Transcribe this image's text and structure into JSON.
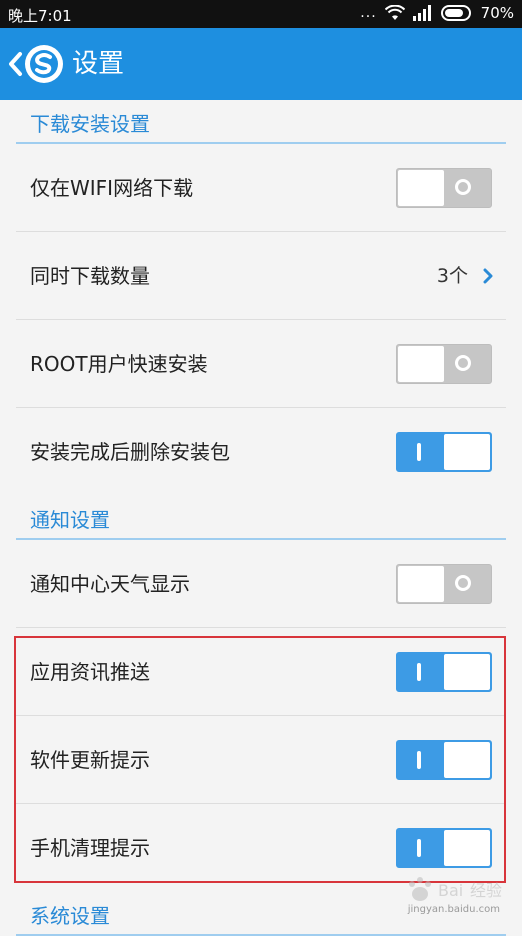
{
  "status_bar": {
    "time": "晚上7:01",
    "dots": "...",
    "battery": "70%"
  },
  "app_bar": {
    "title": "设置"
  },
  "sections": [
    {
      "title": "下载安装设置",
      "rows": [
        {
          "label": "仅在WIFI网络下载",
          "type": "toggle",
          "on": false
        },
        {
          "label": "同时下载数量",
          "type": "value",
          "value": "3个"
        },
        {
          "label": "ROOT用户快速安装",
          "type": "toggle",
          "on": false
        },
        {
          "label": "安装完成后删除安装包",
          "type": "toggle",
          "on": true
        }
      ]
    },
    {
      "title": "通知设置",
      "rows": [
        {
          "label": "通知中心天气显示",
          "type": "toggle",
          "on": false
        },
        {
          "label": "应用资讯推送",
          "type": "toggle",
          "on": true
        },
        {
          "label": "软件更新提示",
          "type": "toggle",
          "on": true
        },
        {
          "label": "手机清理提示",
          "type": "toggle",
          "on": true
        }
      ]
    },
    {
      "title": "系统设置",
      "rows": []
    }
  ],
  "colors": {
    "app_bar": "#1e8fe0",
    "accent": "#2a8ad6",
    "toggle_on": "#3d9be5",
    "toggle_off": "#c6c6c6",
    "highlight": "#d8353b"
  },
  "watermark": {
    "text": "jingyan.baidu.com"
  }
}
